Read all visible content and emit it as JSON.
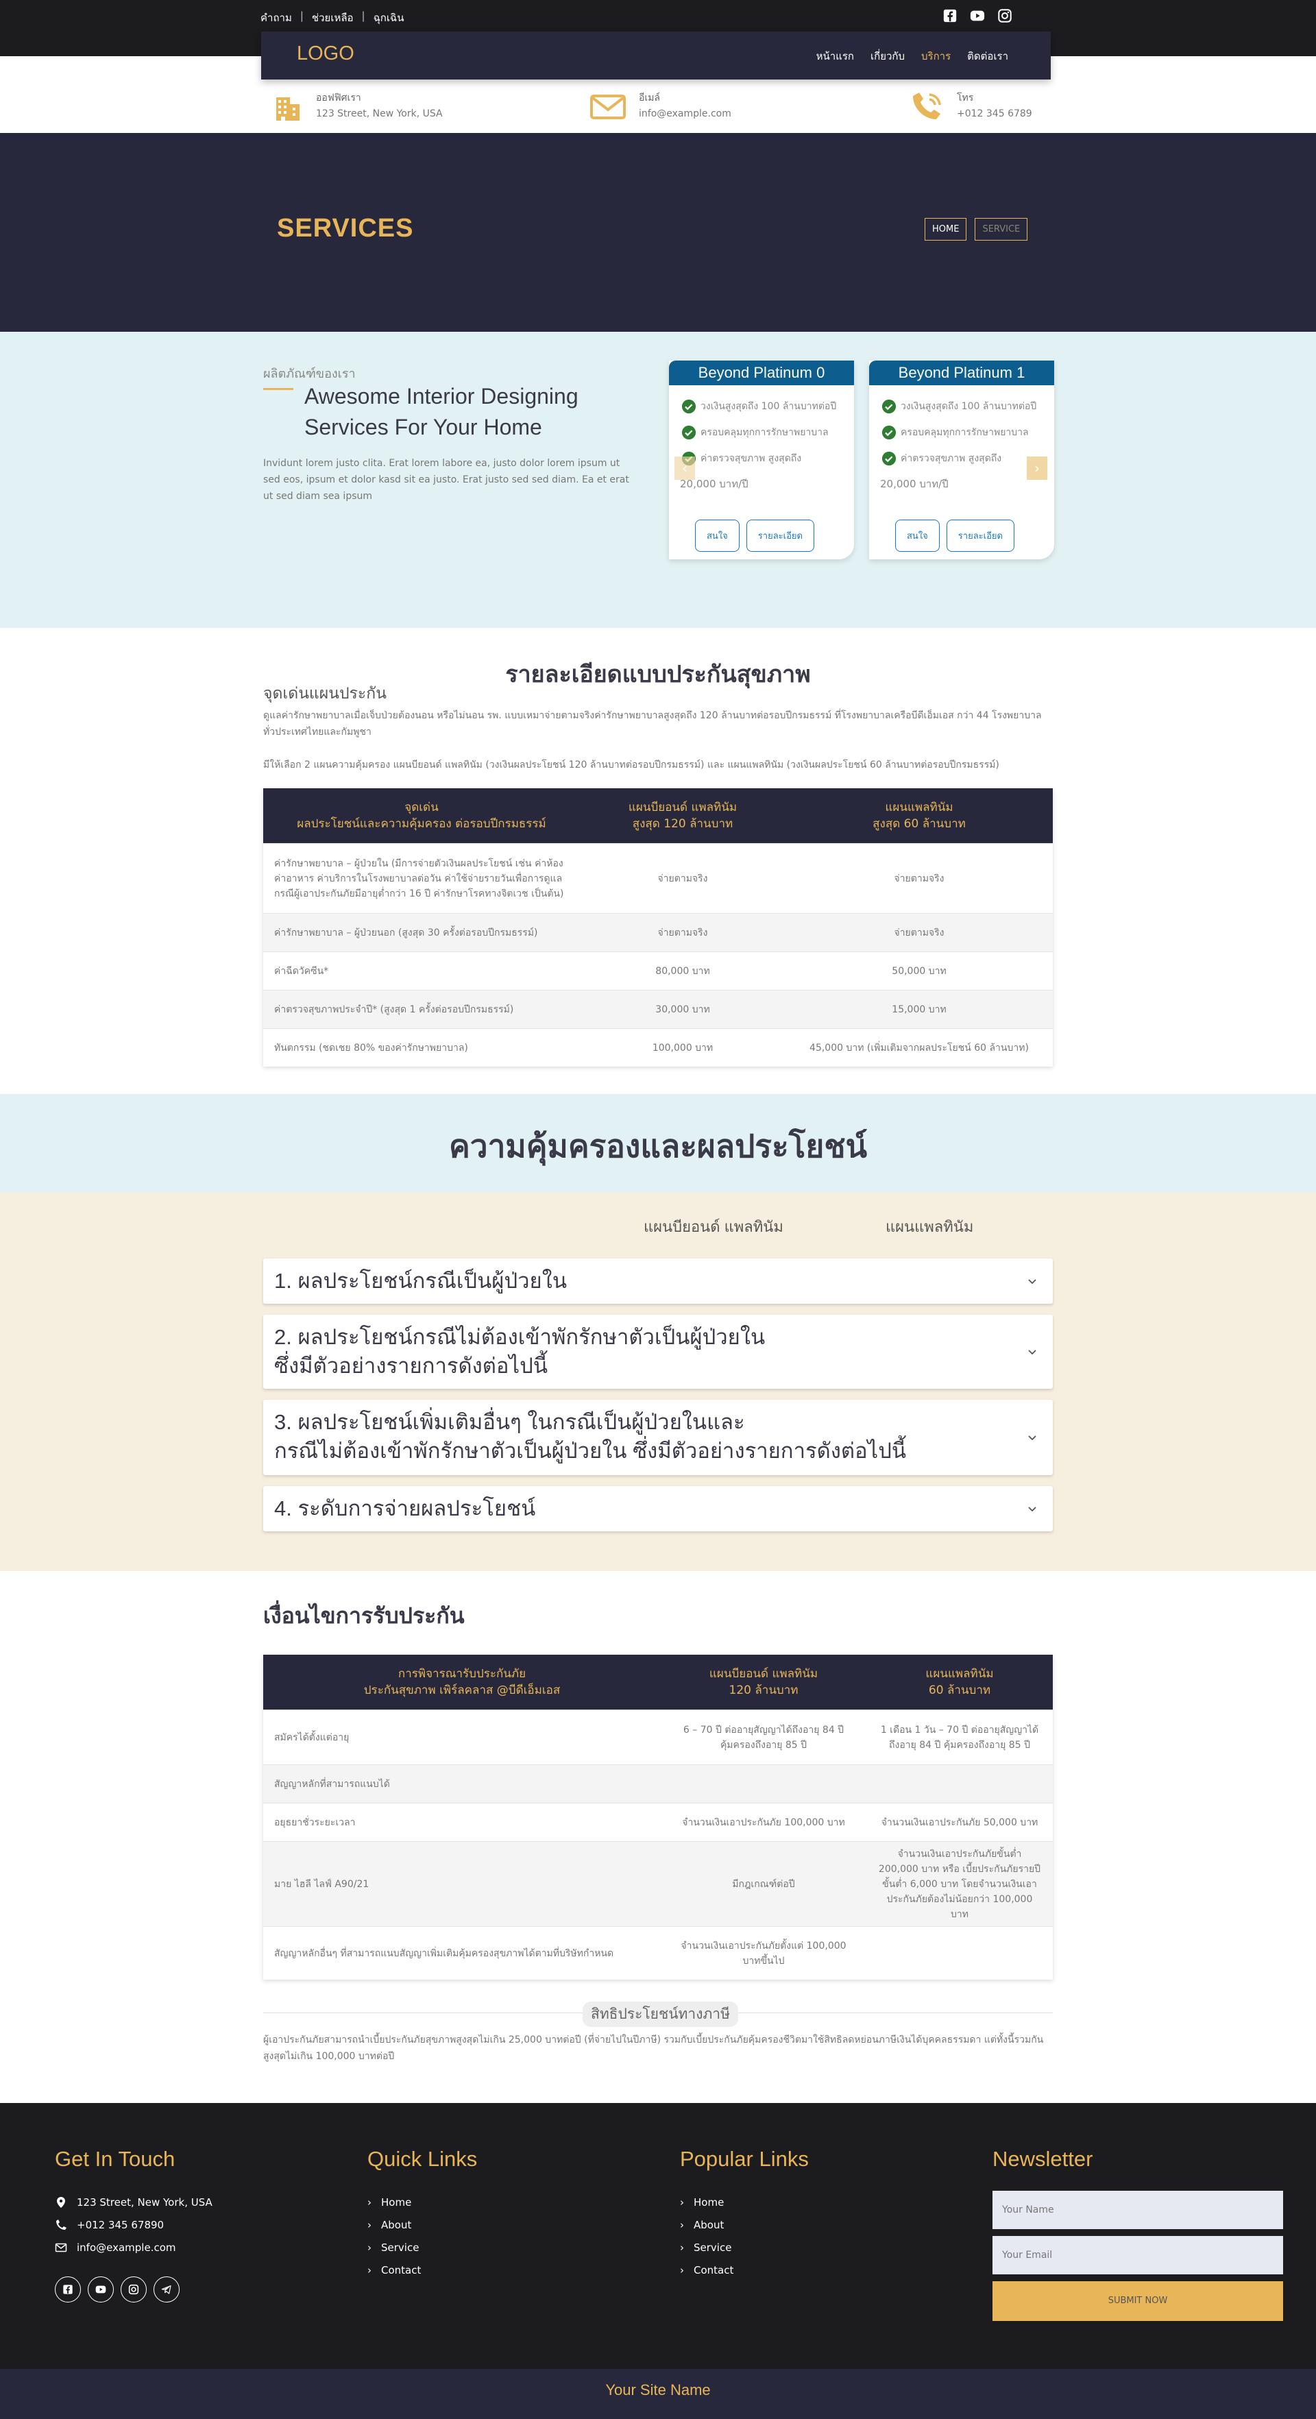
{
  "topbar": {
    "links": [
      "คำถาม",
      "ช่วยเหลือ",
      "ฉุกเฉิน"
    ],
    "sep": "|"
  },
  "nav": {
    "logo": "LOGO",
    "items": [
      "หน้าแรก",
      "เกี่ยวกับ",
      "บริการ",
      "ติดต่อเรา"
    ],
    "active_index": 2,
    "accent": "#e8b558",
    "bg": "#27283b"
  },
  "contact": [
    {
      "icon": "building-icon",
      "title": "ออฟฟิศเรา",
      "value": "123 Street, New York, USA"
    },
    {
      "icon": "mail-icon",
      "title": "อีเมล์",
      "value": "info@example.com"
    },
    {
      "icon": "phone-icon",
      "title": "โทร",
      "value": "+012 345 6789"
    }
  ],
  "hero": {
    "title": "SERVICES",
    "crumbs": [
      "HOME",
      "SERVICE"
    ]
  },
  "products": {
    "kicker": "ผลิตภัณฑ์ของเรา",
    "heading_1": "Awesome Interior Designing",
    "heading_2": "Services For Your Home",
    "desc": "Invidunt lorem justo clita. Erat lorem labore ea, justo dolor lorem ipsum ut sed eos, ipsum et dolor kasd sit ea justo. Erat justo sed sed diam. Ea et erat ut sed diam sea ipsum",
    "cards": [
      {
        "title": "Beyond Platinum 0",
        "lines": [
          "วงเงินสูงสุดถึง 100 ล้านบาทต่อปี",
          "ครอบคลุมทุกการรักษาพยาบาล",
          "ค่าตรวจสุขภาพ สูงสุดถึง"
        ],
        "price": "20,000 บาท/ปี",
        "btn1": "สนใจ",
        "btn2": "รายละเอียด"
      },
      {
        "title": "Beyond Platinum 1",
        "lines": [
          "วงเงินสูงสุดถึง 100 ล้านบาทต่อปี",
          "ครอบคลุมทุกการรักษาพยาบาล",
          "ค่าตรวจสุขภาพ สูงสุดถึง"
        ],
        "price": "20,000 บาท/ปี",
        "btn1": "สนใจ",
        "btn2": "รายละเอียด"
      }
    ],
    "prev": "‹",
    "next": "›"
  },
  "compare": {
    "title": "รายละเอียดแบบประกันสุขภาพ",
    "subtitle": "จุดเด่นแผนประกัน",
    "para1": "ดูแลค่ารักษาพยาบาลเมื่อเจ็บป่วยต้องนอน หรือไม่นอน รพ. แบบเหมาจ่ายตามจริงค่ารักษาพยาบาลสูงสุดถึง 120 ล้านบาทต่อรอบปีกรมธรรม์ ที่โรงพยาบาลเครือบีดีเอ็มเอส กว่า 44 โรงพยาบาลทั่วประเทศไทยและกัมพูชา",
    "para2": "มีให้เลือก 2 แผนความคุ้มครอง แผนบียอนด์ แพลทินัม (วงเงินผลประโยชน์ 120 ล้านบาทต่อรอบปีกรมธรรม์) และ แผนแพลทินัม (วงเงินผลประโยชน์ 60 ล้านบาทต่อรอบปีกรมธรรม์)",
    "headers": [
      [
        "จุดเด่น",
        "ผลประโยชน์และความคุ้มครอง ต่อรอบปีกรมธรรม์"
      ],
      [
        "แผนบียอนด์ แพลทินัม",
        "สูงสุด 120 ล้านบาท"
      ],
      [
        "แผนแพลทินัม",
        "สูงสุด 60 ล้านบาท"
      ]
    ],
    "rows": [
      [
        "ค่ารักษาพยาบาล – ผู้ป่วยใน (มีการจ่ายตัวเงินผลประโยชน์ เช่น ค่าห้อง ค่าอาหาร ค่าบริการในโรงพยาบาลต่อวัน ค่าใช้จ่ายรายวันเพื่อการดูแลกรณีผู้เอาประกันภัยมีอายุต่ำกว่า 16 ปี ค่ารักษาโรคทางจิตเวช เป็นต้น)",
        "จ่ายตามจริง",
        "จ่ายตามจริง"
      ],
      [
        "ค่ารักษาพยาบาล – ผู้ป่วยนอก (สูงสุด 30 ครั้งต่อรอบปีกรมธรรม์)",
        "จ่ายตามจริง",
        "จ่ายตามจริง"
      ],
      [
        "ค่าฉีดวัคซีน*",
        "80,000 บาท",
        "50,000 บาท"
      ],
      [
        "ค่าตรวจสุขภาพประจำปี* (สูงสุด 1 ครั้งต่อรอบปีกรมธรรม์)",
        "30,000 บาท",
        "15,000 บาท"
      ],
      [
        "ทันตกรรม (ชดเชย 80% ของค่ารักษาพยาบาล)",
        "100,000 บาท",
        "45,000 บาท (เพิ่มเติมจากผลประโยชน์ 60 ล้านบาท)"
      ]
    ]
  },
  "coverage": {
    "title": "ความคุ้มครองและผลประโยชน์",
    "col1": "แผนบียอนด์ แพลทินัม",
    "col2": "แผนแพลทินัม",
    "items": [
      [
        "1. ผลประโยชน์กรณีเป็นผู้ป่วยใน"
      ],
      [
        "2. ผลประโยชน์กรณีไม่ต้องเข้าพักรักษาตัวเป็นผู้ป่วยใน",
        "ซึ่งมีตัวอย่างรายการดังต่อไปนี้"
      ],
      [
        "3. ผลประโยชน์เพิ่มเติมอื่นๆ ในกรณีเป็นผู้ป่วยในและ",
        "กรณีไม่ต้องเข้าพักรักษาตัวเป็นผู้ป่วยใน ซึ่งมีตัวอย่างรายการดังต่อไปนี้"
      ],
      [
        "4. ระดับการจ่ายผลประโยชน์"
      ]
    ]
  },
  "conditions": {
    "title": "เงื่อนไขการรับประกัน",
    "headers": [
      [
        "การพิจารณารับประกันภัย",
        "ประกันสุขภาพ เพิร์ลคลาส @บีดีเอ็มเอส"
      ],
      [
        "แผนบียอนด์ แพลทินัม",
        "120 ล้านบาท"
      ],
      [
        "แผนแพลทินัม",
        "60 ล้านบาท"
      ]
    ],
    "rows": [
      [
        "สมัครได้ตั้งแต่อายุ",
        "6 – 70 ปี ต่ออายุสัญญาได้ถึงอายุ 84 ปี คุ้มครองถึงอายุ 85 ปี",
        "1 เดือน 1 วัน – 70 ปี ต่ออายุสัญญาได้ถึงอายุ 84 ปี คุ้มครองถึงอายุ 85 ปี"
      ],
      [
        "สัญญาหลักที่สามารถแนบได้",
        "",
        ""
      ],
      [
        "อยุธยาชั่วระยะเวลา",
        "จำนวนเงินเอาประกันภัย 100,000 บาท",
        "จำนวนเงินเอาประกันภัย 50,000 บาท"
      ],
      [
        "มาย ไฮลี ไลฟ์ A90/21",
        "มีกฎเกณฑ์ต่อปี",
        "จำนวนเงินเอาประกันภัยขั้นต่ำ 200,000 บาท หรือ เบี้ยประกันภัยรายปีขั้นต่ำ 6,000 บาท โดยจำนวนเงินเอาประกันภัยต้องไม่น้อยกว่า 100,000 บาท"
      ],
      [
        "สัญญาหลักอื่นๆ ที่สามารถแนบสัญญาเพิ่มเติมคุ้มครองสุขภาพได้ตามที่บริษัทกำหนด",
        "จำนวนเงินเอาประกันภัยตั้งแต่ 100,000 บาทขึ้นไป",
        ""
      ]
    ],
    "rights": "สิทธิประโยชน์ทางภาษี",
    "note": "ผู้เอาประกันภัยสามารถนำเบี้ยประกันภัยสุขภาพสูงสุดไม่เกิน 25,000 บาทต่อปี (ที่จ่ายไปในปีภาษี) รวมกับเบี้ยประกันภัยคุ้มครองชีวิตมาใช้สิทธิลดหย่อนภาษีเงินได้บุคคลธรรมดา แต่ทั้งนี้รวมกันสูงสุดไม่เกิน 100,000 บาทต่อปี"
  },
  "footer": {
    "touch_title": "Get In Touch",
    "touch": [
      {
        "icon": "location-icon",
        "text": "123 Street, New York, USA"
      },
      {
        "icon": "phone-icon",
        "text": "+012 345 67890"
      },
      {
        "icon": "mail-icon",
        "text": "info@example.com"
      }
    ],
    "quick_title": "Quick Links",
    "quick": [
      "Home",
      "About",
      "Service",
      "Contact"
    ],
    "popular_title": "Popular Links",
    "popular": [
      "Home",
      "About",
      "Service",
      "Contact"
    ],
    "news_title": "Newsletter",
    "name_placeholder": "Your Name",
    "email_placeholder": "Your Email",
    "submit": "SUBMIT NOW",
    "site": "Your Site Name"
  }
}
